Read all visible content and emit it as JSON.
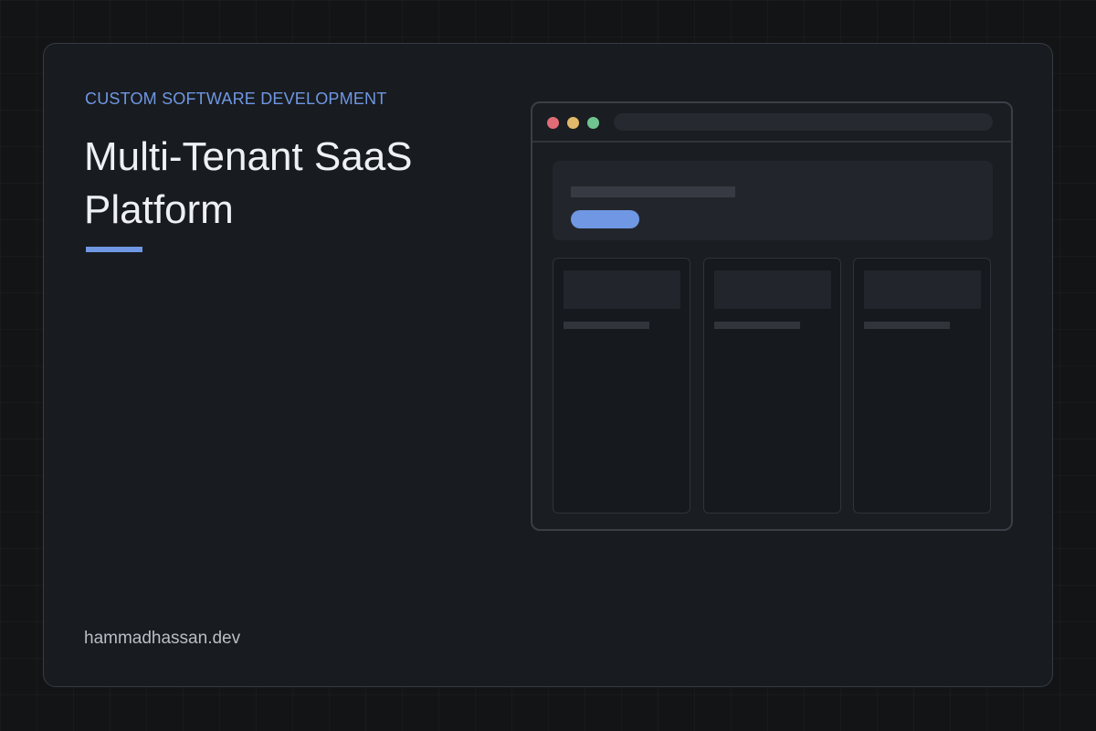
{
  "eyebrow": "CUSTOM SOFTWARE DEVELOPMENT",
  "title": "Multi-Tenant SaaS Platform",
  "site": "hammadhassan.dev",
  "colors": {
    "background": "#121416",
    "card": "#181b1f",
    "accent": "#6f97e3",
    "title_text": "#eef0f3",
    "window_dot_red": "#e06c75",
    "window_dot_yellow": "#e2b86b",
    "window_dot_green": "#6fc48f"
  },
  "browser_mockup": {
    "window_controls": [
      "close-dot",
      "minimize-dot",
      "maximize-dot"
    ],
    "content_cards": [
      "card-1",
      "card-2",
      "card-3"
    ]
  }
}
